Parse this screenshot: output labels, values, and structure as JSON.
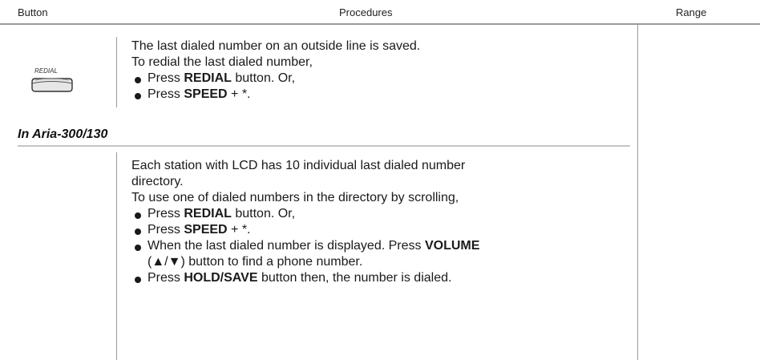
{
  "header": {
    "button_col": "Button",
    "procedures_col": "Procedures",
    "range_col": "Range"
  },
  "section1": {
    "icon_label": "REDIAL",
    "intro_lines": [
      "The last dialed number on an outside line is saved.",
      "To redial the last dialed number,"
    ],
    "bullets": [
      {
        "pre": "Press ",
        "bold": "REDIAL",
        "post": " button. Or,"
      },
      {
        "pre": "Press ",
        "bold": "SPEED",
        "post": " + *."
      }
    ]
  },
  "section_label": "In Aria-300/130",
  "section2": {
    "intro_lines": [
      "Each station with LCD has 10 individual last dialed number",
      "directory.",
      "To use one of dialed numbers in the directory by scrolling,"
    ],
    "bullets": [
      {
        "pre": "Press ",
        "bold": "REDIAL",
        "post": " button. Or,"
      },
      {
        "pre": "Press ",
        "bold": "SPEED",
        "post": " + *."
      },
      {
        "pre": "When the last dialed number is displayed. Press ",
        "bold": "VOLUME",
        "post": ""
      },
      {
        "pre": "Press ",
        "bold": "HOLD/SAVE",
        "post": " button then, the number is dialed."
      }
    ],
    "bullet3_cont": "(▲/▼) button to find a phone number."
  }
}
